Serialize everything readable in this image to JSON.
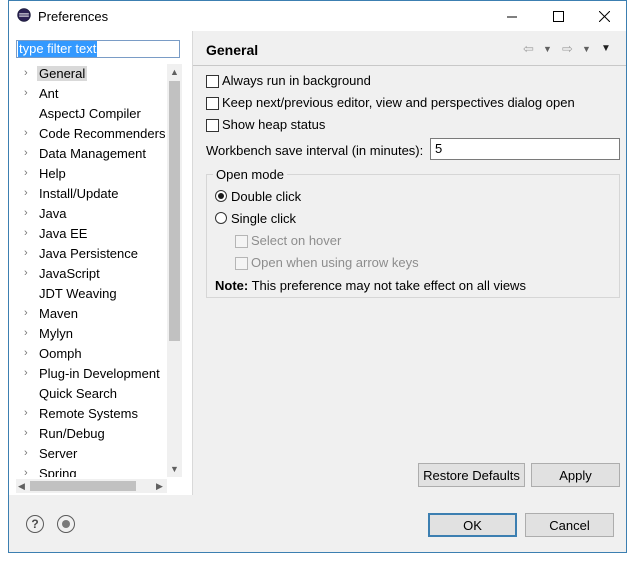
{
  "window": {
    "title": "Preferences",
    "minimize_icon": "minimize-icon",
    "maximize_icon": "maximize-icon",
    "close_icon": "close-icon"
  },
  "filter": {
    "text": "type filter text"
  },
  "tree": {
    "items": [
      {
        "label": "General",
        "expandable": true,
        "selected": true
      },
      {
        "label": "Ant",
        "expandable": true
      },
      {
        "label": "AspectJ Compiler",
        "expandable": false
      },
      {
        "label": "Code Recommenders",
        "expandable": true
      },
      {
        "label": "Data Management",
        "expandable": true
      },
      {
        "label": "Help",
        "expandable": true
      },
      {
        "label": "Install/Update",
        "expandable": true
      },
      {
        "label": "Java",
        "expandable": true
      },
      {
        "label": "Java EE",
        "expandable": true
      },
      {
        "label": "Java Persistence",
        "expandable": true
      },
      {
        "label": "JavaScript",
        "expandable": true
      },
      {
        "label": "JDT Weaving",
        "expandable": false
      },
      {
        "label": "Maven",
        "expandable": true
      },
      {
        "label": "Mylyn",
        "expandable": true
      },
      {
        "label": "Oomph",
        "expandable": true
      },
      {
        "label": "Plug-in Development",
        "expandable": true
      },
      {
        "label": "Quick Search",
        "expandable": false
      },
      {
        "label": "Remote Systems",
        "expandable": true
      },
      {
        "label": "Run/Debug",
        "expandable": true
      },
      {
        "label": "Server",
        "expandable": true
      },
      {
        "label": "Spring",
        "expandable": true
      }
    ]
  },
  "page": {
    "title": "General",
    "options": {
      "always_run_background": {
        "label": "Always run in background",
        "checked": false
      },
      "keep_next_prev": {
        "label": "Keep next/previous editor, view and perspectives dialog open",
        "checked": false
      },
      "show_heap": {
        "label": "Show heap status",
        "checked": false
      }
    },
    "interval": {
      "label": "Workbench save interval (in minutes):",
      "value": "5"
    },
    "open_mode": {
      "title": "Open mode",
      "double_click": "Double click",
      "single_click": "Single click",
      "selected": "double_click",
      "select_on_hover": "Select on hover",
      "open_arrow_keys": "Open when using arrow keys",
      "note_bold": "Note:",
      "note_text": "This preference may not take effect on all views"
    },
    "restore_defaults": "Restore Defaults",
    "apply": "Apply"
  },
  "footer": {
    "ok": "OK",
    "cancel": "Cancel"
  }
}
